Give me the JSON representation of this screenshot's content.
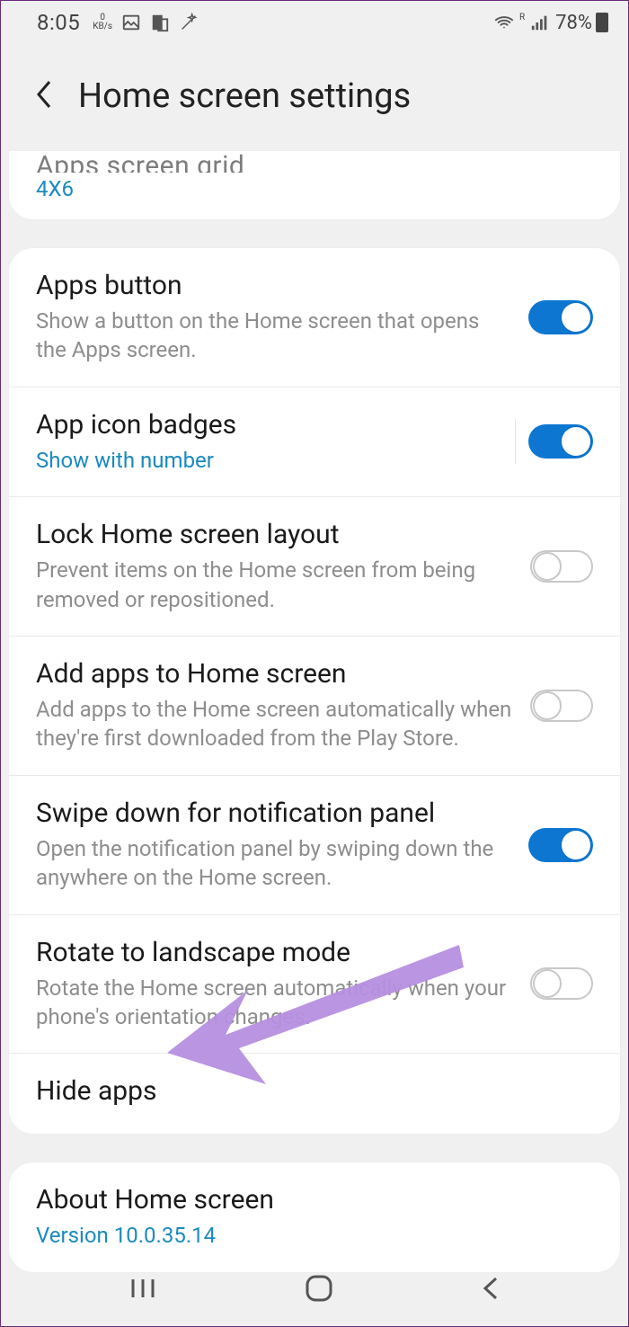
{
  "status": {
    "time": "8:05",
    "kbs_top": "0",
    "kbs_bottom": "KB/s",
    "network_indicator": "R",
    "battery_text": "78%"
  },
  "header": {
    "title": "Home screen settings"
  },
  "grid_card": {
    "title_cut": "Apps screen grid",
    "value": "4X6"
  },
  "settings": [
    {
      "title": "Apps button",
      "sub": "Show a button on the Home screen that opens the Apps screen.",
      "accent": false,
      "toggle": "on",
      "divider": false
    },
    {
      "title": "App icon badges",
      "sub": "Show with number",
      "accent": true,
      "toggle": "on",
      "divider": true
    },
    {
      "title": "Lock Home screen layout",
      "sub": "Prevent items on the Home screen from being removed or repositioned.",
      "accent": false,
      "toggle": "off",
      "divider": false
    },
    {
      "title": "Add apps to Home screen",
      "sub": "Add apps to the Home screen automatically when they're first downloaded from the Play Store.",
      "accent": false,
      "toggle": "off",
      "divider": false
    },
    {
      "title": "Swipe down for notification panel",
      "sub": "Open the notification panel by swiping down the anywhere on the Home screen.",
      "accent": false,
      "toggle": "on",
      "divider": false
    },
    {
      "title": "Rotate to landscape mode",
      "sub": "Rotate the Home screen automatically when your phone's orientation changes.",
      "accent": false,
      "toggle": "off",
      "divider": false
    }
  ],
  "hide_apps": {
    "title": "Hide apps"
  },
  "about": {
    "title": "About Home screen",
    "version": "Version 10.0.35.14"
  },
  "annotation": {
    "color": "#b68fe0"
  }
}
